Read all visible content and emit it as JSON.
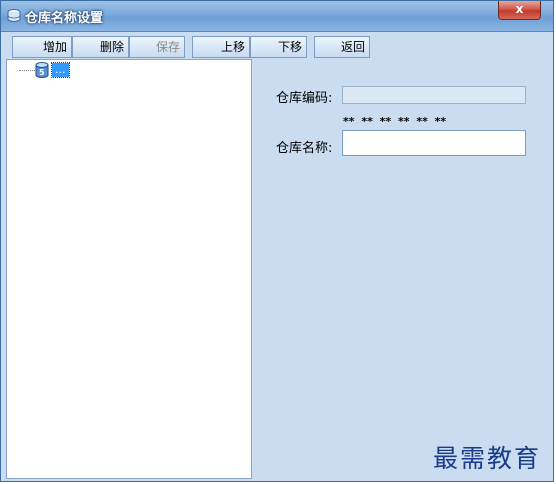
{
  "window": {
    "title": "仓库名称设置",
    "close_label": "x"
  },
  "toolbar": {
    "buttons": [
      {
        "label": "增加",
        "enabled": true
      },
      {
        "label": "删除",
        "enabled": true
      },
      {
        "label": "保存",
        "enabled": false
      },
      {
        "label": "上移",
        "enabled": true
      },
      {
        "label": "下移",
        "enabled": true
      },
      {
        "label": "返回",
        "enabled": true
      }
    ]
  },
  "tree": {
    "root_label": "..."
  },
  "form": {
    "code_label": "仓库编码:",
    "code_value": "",
    "code_mask": "** ** ** ** ** **",
    "name_label": "仓库名称:",
    "name_value": ""
  },
  "watermark": "最需教育",
  "colors": {
    "window_bg": "#c9dcf0",
    "selection": "#3399ff",
    "close_button": "#c03b2c"
  }
}
